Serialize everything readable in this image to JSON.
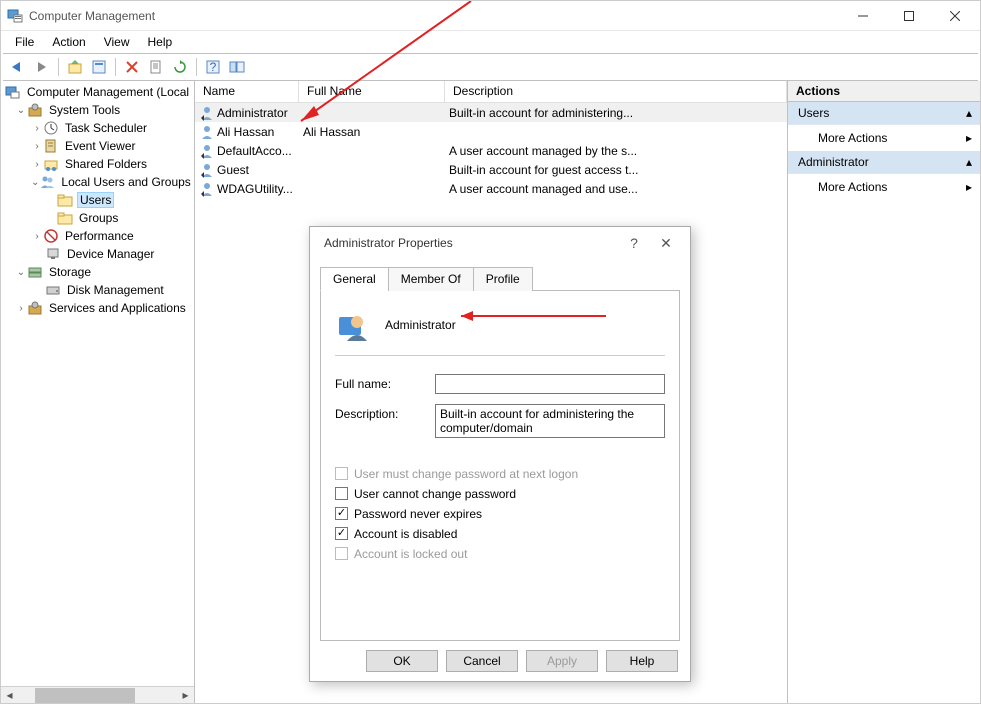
{
  "window": {
    "title": "Computer Management"
  },
  "menus": {
    "file": "File",
    "action": "Action",
    "view": "View",
    "help": "Help"
  },
  "tree": {
    "root": "Computer Management (Local",
    "systools": "System Tools",
    "task_scheduler": "Task Scheduler",
    "event_viewer": "Event Viewer",
    "shared_folders": "Shared Folders",
    "local_users": "Local Users and Groups",
    "users": "Users",
    "groups": "Groups",
    "performance": "Performance",
    "device_manager": "Device Manager",
    "storage": "Storage",
    "disk_mgmt": "Disk Management",
    "services": "Services and Applications"
  },
  "list": {
    "col_name": "Name",
    "col_fullname": "Full Name",
    "col_desc": "Description",
    "rows": [
      {
        "name": "Administrator",
        "fullname": "",
        "desc": "Built-in account for administering..."
      },
      {
        "name": "Ali Hassan",
        "fullname": "Ali Hassan",
        "desc": ""
      },
      {
        "name": "DefaultAcco...",
        "fullname": "",
        "desc": "A user account managed by the s..."
      },
      {
        "name": "Guest",
        "fullname": "",
        "desc": "Built-in account for guest access t..."
      },
      {
        "name": "WDAGUtility...",
        "fullname": "",
        "desc": "A user account managed and use..."
      }
    ]
  },
  "actions": {
    "header": "Actions",
    "section1": "Users",
    "more1": "More Actions",
    "section2": "Administrator",
    "more2": "More Actions"
  },
  "dialog": {
    "title": "Administrator Properties",
    "tabs": {
      "general": "General",
      "memberof": "Member Of",
      "profile": "Profile"
    },
    "username": "Administrator",
    "labels": {
      "fullname": "Full name:",
      "description": "Description:"
    },
    "fullname_value": "",
    "description_value": "Built-in account for administering the computer/domain",
    "checks": {
      "must_change": "User must change password at next logon",
      "cannot_change": "User cannot change password",
      "never_expires": "Password never expires",
      "disabled": "Account is disabled",
      "locked": "Account is locked out"
    },
    "buttons": {
      "ok": "OK",
      "cancel": "Cancel",
      "apply": "Apply",
      "help": "Help"
    }
  }
}
